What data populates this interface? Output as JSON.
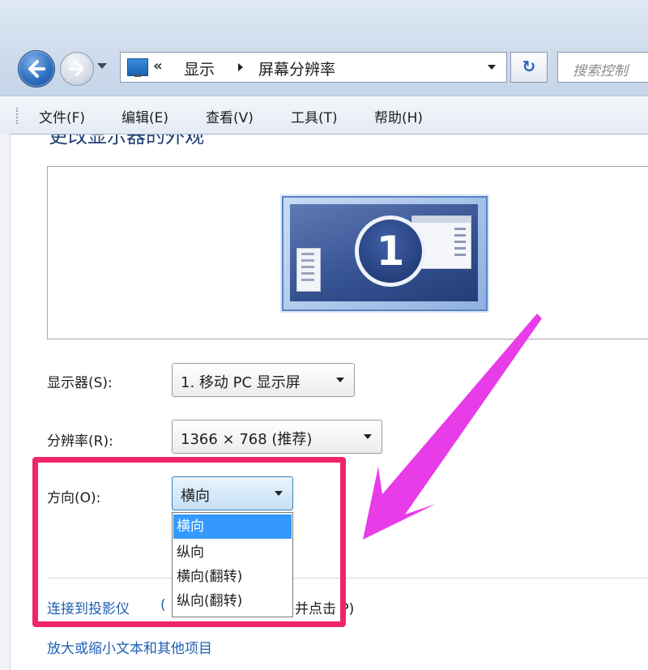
{
  "address_bar": {
    "chevron": "«",
    "segment_1": "显示",
    "segment_2": "屏幕分辨率",
    "search_placeholder": "搜索控制"
  },
  "menu": [
    "文件(F)",
    "编辑(E)",
    "查看(V)",
    "工具(T)",
    "帮助(H)"
  ],
  "heading": "更改显示器的外观",
  "monitor_badge": "1",
  "display": {
    "label": "显示器(S):",
    "value": "1. 移动 PC 显示屏"
  },
  "resolution": {
    "label": "分辨率(R):",
    "value": "1366 × 768 (推荐)"
  },
  "orientation": {
    "label": "方向(O):",
    "value": "横向",
    "options": [
      "横向",
      "纵向",
      "横向(翻转)",
      "纵向(翻转)"
    ],
    "highlighted_index": 0
  },
  "links": {
    "projector_prefix": "连接到投影仪",
    "projector_hidden_fragment": "(",
    "projector_suffix": "并点击 P)",
    "text_size": "放大或缩小文本和其他项目"
  },
  "colors": {
    "annotation": "#f0246a",
    "arrow": "#e83ce8",
    "selection": "#3399ff",
    "link": "#1f5fb3"
  }
}
